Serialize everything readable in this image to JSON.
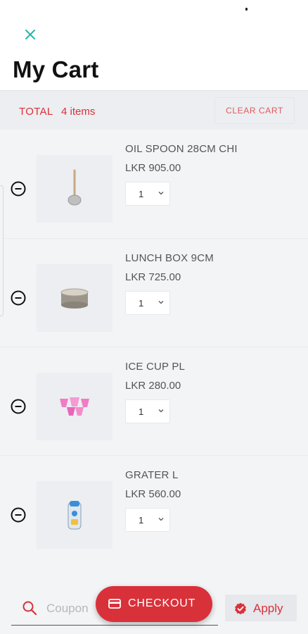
{
  "header": {
    "title": "My Cart",
    "close_icon": "close-icon"
  },
  "summary": {
    "total_label": "TOTAL",
    "item_count": "4 items",
    "clear_label": "CLEAR CART"
  },
  "items": [
    {
      "name": "OIL SPOON 28CM CHI",
      "price": "LKR 905.00",
      "qty": "1",
      "image": "oil-spoon-image"
    },
    {
      "name": "LUNCH BOX 9CM",
      "price": "LKR 725.00",
      "qty": "1",
      "image": "lunch-box-image"
    },
    {
      "name": "ICE CUP PL",
      "price": "LKR 280.00",
      "qty": "1",
      "image": "ice-cup-image"
    },
    {
      "name": "GRATER L",
      "price": "LKR 560.00",
      "qty": "1",
      "image": "grater-image"
    }
  ],
  "coupon": {
    "placeholder": "Coupon",
    "value": "",
    "apply_label": "Apply"
  },
  "checkout": {
    "label": "CHECKOUT"
  },
  "colors": {
    "accent": "#d9313a",
    "close": "#2bb5ad",
    "background": "#f3f4f6"
  }
}
